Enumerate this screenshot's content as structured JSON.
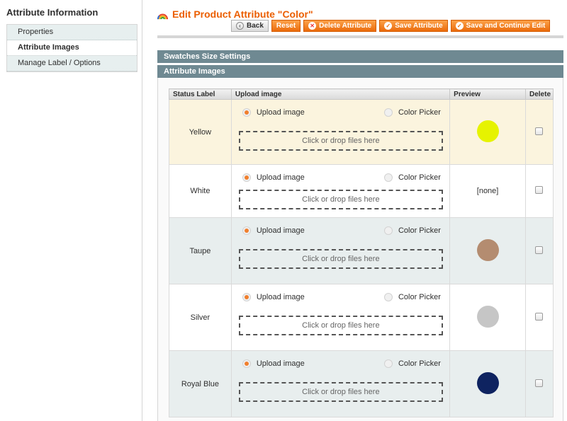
{
  "sidebar": {
    "title": "Attribute Information",
    "items": [
      {
        "label": "Properties",
        "active": false
      },
      {
        "label": "Attribute Images",
        "active": true
      },
      {
        "label": "Manage Label / Options",
        "active": false
      }
    ]
  },
  "header": {
    "title": "Edit Product Attribute \"Color\"",
    "buttons": {
      "back": "Back",
      "reset": "Reset",
      "delete": "Delete Attribute",
      "save": "Save Attribute",
      "save_continue": "Save and Continue Edit"
    }
  },
  "sections": {
    "swatches": "Swatches Size Settings",
    "images": "Attribute Images"
  },
  "table": {
    "headers": [
      "Status Label",
      "Upload image",
      "Preview",
      "Delete"
    ],
    "upload_option": "Upload image",
    "picker_option": "Color Picker",
    "drop_text": "Click or drop files here",
    "rows": [
      {
        "label": "Yellow",
        "preview": "",
        "color": "#e6f300"
      },
      {
        "label": "White",
        "preview": "[none]",
        "color": ""
      },
      {
        "label": "Taupe",
        "preview": "",
        "color": "#b48c70"
      },
      {
        "label": "Silver",
        "preview": "",
        "color": "#c6c6c6"
      },
      {
        "label": "Royal Blue",
        "preview": "",
        "color": "#0e2360"
      }
    ]
  },
  "colors": {
    "accent": "#eb5e00",
    "section_header": "#6f8992"
  }
}
